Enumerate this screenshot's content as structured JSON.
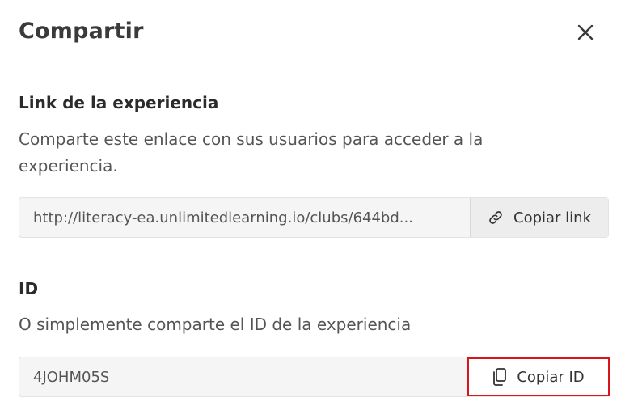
{
  "dialog": {
    "title": "Compartir"
  },
  "link_section": {
    "heading": "Link de la experiencia",
    "description": "Comparte este enlace con sus usuarios para acceder a la experiencia.",
    "url": "http://literacy-ea.unlimitedlearning.io/clubs/644bd...",
    "copy_label": "Copiar link"
  },
  "id_section": {
    "heading": "ID",
    "description": "O simplemente comparte el ID de la experiencia",
    "id_value": "4JOHM05S",
    "copy_label": "Copiar ID"
  },
  "colors": {
    "highlight": "#d9141b",
    "field_bg": "#f5f5f5"
  },
  "icons": {
    "close": "close-icon",
    "link": "link-icon",
    "copy": "copy-icon"
  }
}
